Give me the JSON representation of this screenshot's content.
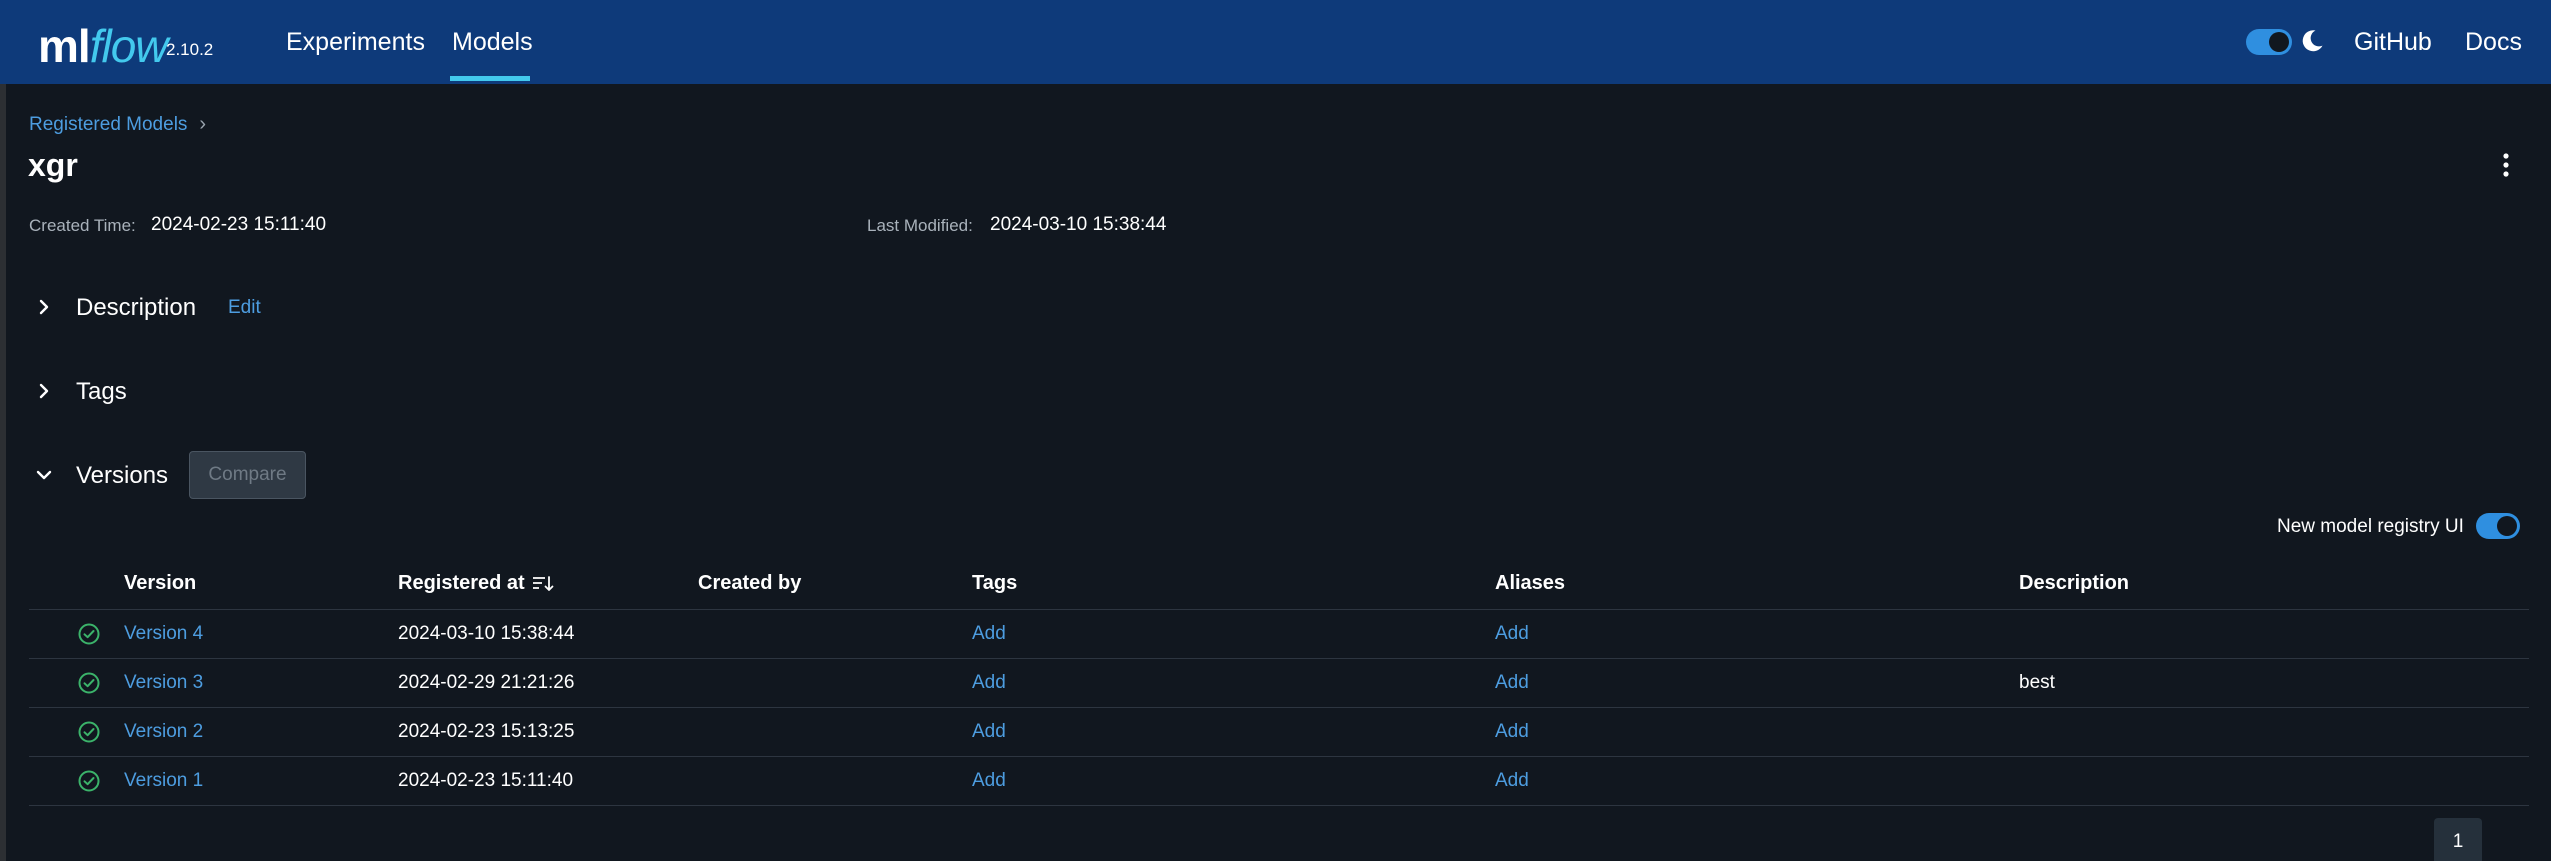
{
  "app": {
    "logo_ml": "ml",
    "logo_flow": "flow",
    "version": "2.10.2"
  },
  "nav": {
    "experiments": "Experiments",
    "models": "Models",
    "github": "GitHub",
    "docs": "Docs",
    "theme_toggle_on": true
  },
  "breadcrumb": {
    "parent": "Registered Models",
    "separator": "›"
  },
  "model": {
    "name": "xgr",
    "created_label": "Created Time:",
    "created_value": "2024-02-23 15:11:40",
    "modified_label": "Last Modified:",
    "modified_value": "2024-03-10 15:38:44"
  },
  "sections": {
    "description": "Description",
    "edit": "Edit",
    "tags": "Tags",
    "versions": "Versions",
    "compare": "Compare"
  },
  "registry_toggle": {
    "label": "New model registry UI",
    "enabled": true
  },
  "table": {
    "headers": {
      "version": "Version",
      "registered_at": "Registered at",
      "created_by": "Created by",
      "tags": "Tags",
      "aliases": "Aliases",
      "description": "Description"
    },
    "rows": [
      {
        "version": "Version 4",
        "registered_at": "2024-03-10 15:38:44",
        "created_by": "",
        "tags": "Add",
        "aliases": "Add",
        "description": ""
      },
      {
        "version": "Version 3",
        "registered_at": "2024-02-29 21:21:26",
        "created_by": "",
        "tags": "Add",
        "aliases": "Add",
        "description": "best"
      },
      {
        "version": "Version 2",
        "registered_at": "2024-02-23 15:13:25",
        "created_by": "",
        "tags": "Add",
        "aliases": "Add",
        "description": ""
      },
      {
        "version": "Version 1",
        "registered_at": "2024-02-23 15:11:40",
        "created_by": "",
        "tags": "Add",
        "aliases": "Add",
        "description": ""
      }
    ]
  },
  "pagination": {
    "current_page": "1"
  },
  "colors": {
    "header_bg": "#0e3a7a",
    "page_bg": "#11171f",
    "accent": "#43c9ed",
    "link": "#4d9de0",
    "status_ready": "#3bb36a"
  }
}
